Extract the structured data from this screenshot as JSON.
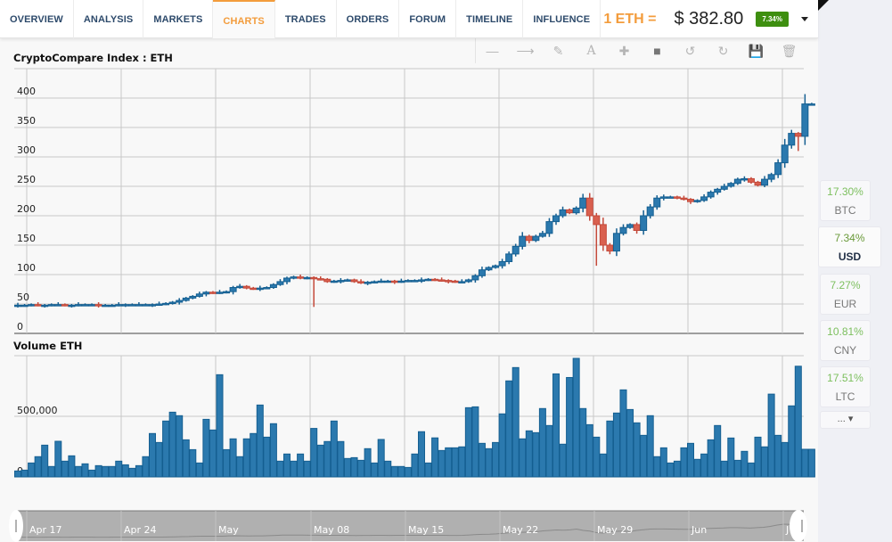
{
  "nav": {
    "tabs": [
      {
        "label": "OVERVIEW",
        "active": false
      },
      {
        "label": "ANALYSIS",
        "active": false
      },
      {
        "label": "MARKETS",
        "active": false
      },
      {
        "label": "CHARTS",
        "active": true
      },
      {
        "label": "TRADES",
        "active": false
      },
      {
        "label": "ORDERS",
        "active": false
      },
      {
        "label": "FORUM",
        "active": false
      },
      {
        "label": "TIMELINE",
        "active": false
      },
      {
        "label": "INFLUENCE",
        "active": false
      }
    ]
  },
  "price": {
    "label": "1 ETH =",
    "value": "$ 382.80",
    "change": "7.34%",
    "change_color": "#3e8f10"
  },
  "toolbar": {
    "tools": [
      {
        "name": "line-tool-icon",
        "glyph": "—"
      },
      {
        "name": "arrow-tool-icon",
        "glyph": "⟶"
      },
      {
        "name": "pencil-icon",
        "glyph": "✎"
      },
      {
        "name": "text-tool-icon",
        "glyph": "A"
      },
      {
        "name": "crosshair-icon",
        "glyph": "✚"
      },
      {
        "name": "rectangle-icon",
        "glyph": "■"
      },
      {
        "name": "undo-icon",
        "glyph": "↺"
      },
      {
        "name": "redo-icon",
        "glyph": "↻"
      },
      {
        "name": "save-icon",
        "glyph": "💾"
      },
      {
        "name": "trash-icon",
        "glyph": "🗑"
      }
    ]
  },
  "sidebar": {
    "currencies": [
      {
        "pct": "17.30%",
        "code": "BTC",
        "active": false
      },
      {
        "pct": "7.34%",
        "code": "USD",
        "active": true
      },
      {
        "pct": "7.27%",
        "code": "EUR",
        "active": false
      },
      {
        "pct": "10.81%",
        "code": "CNY",
        "active": false
      },
      {
        "pct": "17.51%",
        "code": "LTC",
        "active": false
      }
    ],
    "more_label": "... ▾"
  },
  "colors": {
    "up": "#2b79ae",
    "up_border": "#155f91",
    "down": "#d9604f",
    "down_border": "#c4493a",
    "grid": "#c8c8c8",
    "navigator": "#b0b0b0"
  },
  "chart_data": [
    {
      "type": "candlestick",
      "title": "CryptoCompare Index : ETH",
      "ylim": [
        0,
        450
      ],
      "yticks": [
        0,
        50,
        100,
        150,
        200,
        250,
        300,
        350,
        400
      ],
      "ytick_labels": [
        "0",
        "50",
        "100",
        "150",
        "200",
        "250",
        "300",
        "350",
        "400"
      ],
      "grid": true,
      "interval": "12h",
      "x_labels": [
        "Apr 17",
        "Apr 24",
        "May",
        "May 08",
        "May 15",
        "May 22",
        "May 29",
        "Jun",
        "J"
      ],
      "close": [
        48,
        48,
        49,
        48,
        48,
        49,
        49,
        48,
        48,
        49,
        49,
        49,
        48,
        48,
        48,
        49,
        49,
        49,
        49,
        49,
        49,
        50,
        51,
        53,
        56,
        60,
        63,
        67,
        70,
        69,
        70,
        71,
        78,
        80,
        77,
        76,
        77,
        78,
        83,
        88,
        94,
        96,
        94,
        95,
        93,
        92,
        88,
        89,
        90,
        91,
        88,
        86,
        87,
        88,
        89,
        89,
        88,
        89,
        90,
        90,
        91,
        92,
        91,
        90,
        89,
        88,
        88,
        91,
        98,
        108,
        112,
        115,
        122,
        135,
        148,
        165,
        158,
        165,
        170,
        190,
        200,
        210,
        205,
        213,
        230,
        200,
        185,
        150,
        140,
        170,
        180,
        185,
        175,
        200,
        215,
        230,
        232,
        232,
        230,
        228,
        224,
        226,
        232,
        240,
        245,
        250,
        255,
        262,
        263,
        257,
        252,
        262,
        270,
        290,
        320,
        340,
        335,
        390,
        390
      ]
    },
    {
      "type": "bar",
      "title": "Volume ETH",
      "ylim": [
        0,
        1000000
      ],
      "yticks": [
        0,
        500000
      ],
      "ytick_labels": [
        "0",
        "500,000"
      ],
      "grid": true,
      "values": [
        49000,
        56000,
        115000,
        167000,
        262000,
        86000,
        294000,
        130000,
        174000,
        86000,
        108000,
        56000,
        93000,
        86000,
        86000,
        130000,
        100000,
        71000,
        93000,
        167000,
        358000,
        284000,
        461000,
        534000,
        505000,
        306000,
        225000,
        115000,
        475000,
        387000,
        843000,
        225000,
        314000,
        167000,
        314000,
        358000,
        593000,
        328000,
        439000,
        130000,
        189000,
        130000,
        189000,
        130000,
        400000,
        262000,
        292000,
        461000,
        292000,
        152000,
        159000,
        137000,
        233000,
        115000,
        309000,
        130000,
        86000,
        86000,
        78000,
        189000,
        373000,
        115000,
        322000,
        218000,
        240000,
        240000,
        248000,
        571000,
        578000,
        277000,
        233000,
        284000,
        520000,
        792000,
        902000,
        314000,
        380000,
        365000,
        564000,
        424000,
        850000,
        270000,
        820000,
        978000,
        564000,
        431000,
        328000,
        189000,
        461000,
        527000,
        718000,
        556000,
        446000,
        343000,
        505000,
        167000,
        240000,
        115000,
        130000,
        240000,
        277000,
        145000,
        189000,
        306000,
        424000,
        130000,
        321000,
        137000,
        211000,
        115000,
        328000,
        248000,
        683000,
        343000,
        284000,
        586000,
        913000,
        228000,
        228000
      ]
    }
  ]
}
